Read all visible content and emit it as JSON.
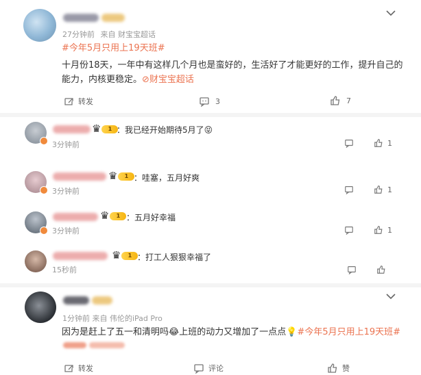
{
  "post": {
    "time": "27分钟前",
    "source": "来自 财宝宝超话",
    "topic": "#今年5月只用上19天班#",
    "body_line1": "十月份18天，一年中有这样几个月也是蛮好的，生活好了才能更好的工作，提升自己的",
    "body_line2": "能力，内核更稳定。",
    "super_topic": "财宝宝超话",
    "repost_label": "转发",
    "comment_count": "3",
    "like_count": "7"
  },
  "replies": [
    {
      "text": "我已经开始期待5月了",
      "emoji": "😝",
      "time": "3分钟前",
      "likes": "1",
      "level": "1"
    },
    {
      "text": "哇塞，五月好爽",
      "time": "3分钟前",
      "likes": "1",
      "level": "1"
    },
    {
      "text": "五月好幸福",
      "time": "3分钟前",
      "likes": "1",
      "level": "1"
    },
    {
      "text": "打工人狠狠幸福了",
      "time": "15秒前",
      "likes": "",
      "level": "1"
    }
  ],
  "post2": {
    "time_source": "1分钟前  来自 伟伦的iPad Pro",
    "body_prefix": "因为是赶上了五一和清明吗",
    "emoji": "😂",
    "body_mid": "上班的动力又增加了一点点",
    "bulb": "💡",
    "topic": "#今年5月只用上19天班#",
    "repost_label": "转发",
    "comment_label": "评论",
    "like_label": "赞"
  },
  "colors": {
    "accent": "#eb7350",
    "badge": "#f6b512"
  }
}
